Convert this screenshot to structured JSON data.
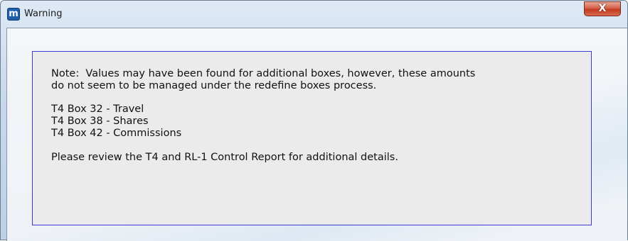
{
  "window": {
    "title": "Warning",
    "app_icon_letter": "m",
    "close_glyph": "X"
  },
  "message": {
    "note_line1": "Note:  Values may have been found for additional boxes, however, these amounts",
    "note_line2": "do not seem to be managed under the redefine boxes process.",
    "boxes": [
      "T4 Box 32 - Travel",
      "T4 Box 38 - Shares",
      "T4 Box 42 - Commissions"
    ],
    "review": "Please review the T4 and RL-1 Control Report for additional details."
  },
  "colors": {
    "panel_border": "#3b3bd6",
    "close_button": "#c4391f",
    "app_icon": "#1f5fa8"
  },
  "icons": {
    "app": "app-m-icon",
    "close": "close-x-icon"
  }
}
